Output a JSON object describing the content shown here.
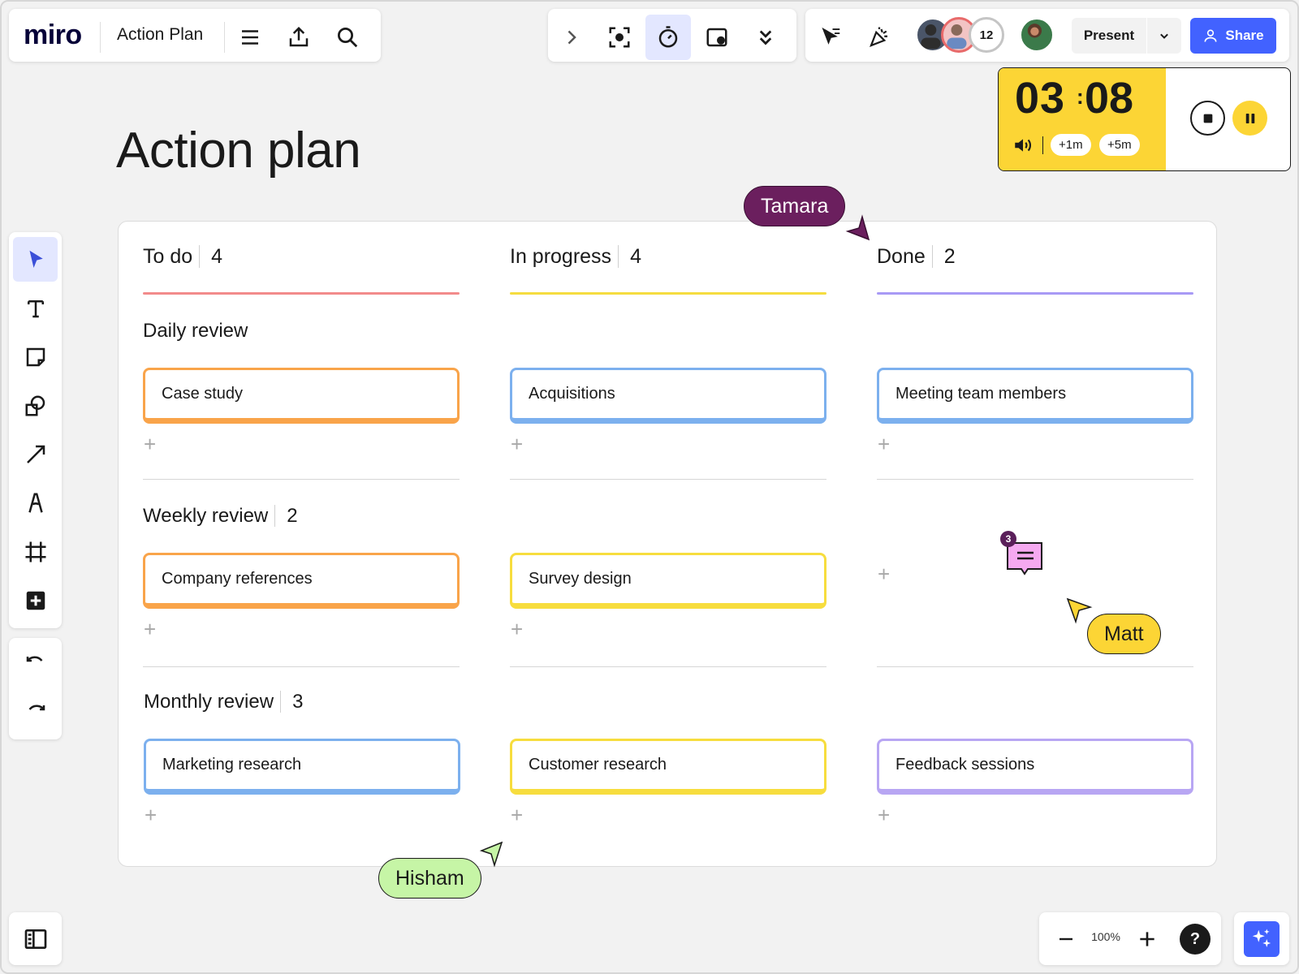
{
  "app": {
    "logo": "miro",
    "board_title": "Action Plan"
  },
  "toolbar_top_left": {
    "icons": [
      "menu-icon",
      "upload-icon",
      "search-icon"
    ]
  },
  "toolbar_top_mid": {
    "icons": [
      "chevron-right-icon",
      "focus-icon",
      "timer-icon",
      "video-frame-icon",
      "double-chevron-down-icon"
    ]
  },
  "collab": {
    "icons": [
      "cursor-follow-icon",
      "celebrate-icon"
    ],
    "avatar_count": "12",
    "present_label": "Present",
    "share_label": "Share"
  },
  "timer": {
    "minutes": "03",
    "separator": ":",
    "seconds": "08",
    "add_1m": "+1m",
    "add_5m": "+5m",
    "bg_color": "#fcd535"
  },
  "page_title": "Action plan",
  "columns": [
    {
      "title": "To do",
      "count": "4",
      "color": "#f28b8b"
    },
    {
      "title": "In progress",
      "count": "4",
      "color": "#f5dc3f"
    },
    {
      "title": "Done",
      "count": "2",
      "color": "#a89af5"
    }
  ],
  "rows": [
    {
      "title": "Daily review",
      "count": ""
    },
    {
      "title": "Weekly review",
      "count": "2"
    },
    {
      "title": "Monthly review",
      "count": "3"
    }
  ],
  "cards": {
    "daily_todo": "Case study",
    "daily_progress": "Acquisitions",
    "daily_done": "Meeting team members",
    "weekly_todo": "Company references",
    "weekly_progress": "Survey design",
    "monthly_todo": "Marketing research",
    "monthly_progress": "Customer research",
    "monthly_done": "Feedback sessions"
  },
  "card_colors": {
    "orange": "#f9a44a",
    "blue": "#7cb0ee",
    "yellow": "#f7dd3e",
    "purple": "#b8a6f3"
  },
  "comment_badge": "3",
  "cursors": {
    "tamara": "Tamara",
    "matt": "Matt",
    "hisham": "Hisham"
  },
  "zoom": {
    "level": "100%",
    "help": "?"
  }
}
